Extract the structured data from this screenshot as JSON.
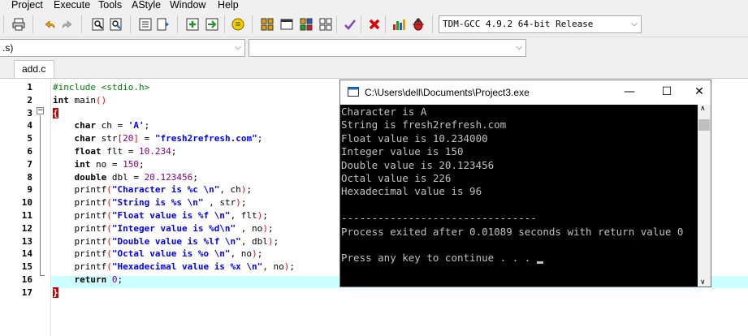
{
  "menu": [
    "Project",
    "Execute",
    "Tools",
    "AStyle",
    "Window",
    "Help"
  ],
  "compiler_select": "TDM-GCC 4.9.2 64-bit Release",
  "scope_select": ".s)",
  "tab_label": "add.c",
  "code_lines": [
    {
      "n": "1",
      "html": "<span class='pp'>#include &lt;stdio.h&gt;</span>"
    },
    {
      "n": "2",
      "html": "<span class='kw'>int</span> main<span class='pn'>()</span>"
    },
    {
      "n": "3",
      "html": "<span class='brace-red'>{</span>"
    },
    {
      "n": "4",
      "html": "    <span class='kw'>char</span> ch = <span class='str'>'A'</span>;"
    },
    {
      "n": "5",
      "html": "    <span class='kw'>char</span> str<span class='pn'>[</span><span class='num'>20</span><span class='pn'>]</span> = <span class='str'>\"fresh2refresh.com\"</span>;"
    },
    {
      "n": "6",
      "html": "    <span class='kw'>float</span> flt = <span class='num'>10.234</span>;"
    },
    {
      "n": "7",
      "html": "    <span class='kw'>int</span> no = <span class='num'>150</span>;"
    },
    {
      "n": "8",
      "html": "    <span class='kw'>double</span> dbl = <span class='num'>20.123456</span>;"
    },
    {
      "n": "9",
      "html": "    printf<span class='pn'>(</span><span class='str'>\"Character is %c \\n\"</span>, ch<span class='pn'>)</span>;"
    },
    {
      "n": "10",
      "html": "    printf<span class='pn'>(</span><span class='str'>\"String is %s \\n\"</span> , str<span class='pn'>)</span>;"
    },
    {
      "n": "11",
      "html": "    printf<span class='pn'>(</span><span class='str'>\"Float value is %f \\n\"</span>, flt<span class='pn'>)</span>;"
    },
    {
      "n": "12",
      "html": "    printf<span class='pn'>(</span><span class='str'>\"Integer value is %d\\n\"</span> , no<span class='pn'>)</span>;"
    },
    {
      "n": "13",
      "html": "    printf<span class='pn'>(</span><span class='str'>\"Double value is %lf \\n\"</span>, dbl<span class='pn'>)</span>;"
    },
    {
      "n": "14",
      "html": "    printf<span class='pn'>(</span><span class='str'>\"Octal value is %o \\n\"</span>, no<span class='pn'>)</span>;"
    },
    {
      "n": "15",
      "html": "    printf<span class='pn'>(</span><span class='str'>\"Hexadecimal value is %x \\n\"</span>, no<span class='pn'>)</span>;"
    },
    {
      "n": "16",
      "html": "    <span class='kw'>return</span> <span class='num'>0</span>;"
    },
    {
      "n": "17",
      "html": "<span class='brace-red'>}</span>"
    }
  ],
  "console": {
    "title": "C:\\Users\\dell\\Documents\\Project3.exe",
    "lines": [
      "Character is A",
      "String is fresh2refresh.com",
      "Float value is 10.234000",
      "Integer value is 150",
      "Double value is 20.123456",
      "Octal value is 226",
      "Hexadecimal value is 96",
      "",
      "--------------------------------",
      "Process exited after 0.01089 seconds with return value 0",
      "",
      "Press any key to continue . . . "
    ]
  },
  "colors": {
    "accent_line": "#ccffff",
    "keyword_string": "#0000ff",
    "preprocessor": "#008000",
    "number": "#800080"
  },
  "icons": [
    "print-icon",
    "undo-icon",
    "redo-icon",
    "find-icon",
    "replace-icon",
    "indent-icon",
    "unindent-icon",
    "add-bookmark-icon",
    "goto-bookmark-icon",
    "toggle-comment-icon",
    "compile-icon",
    "run-icon",
    "compile-run-icon",
    "rebuild-icon",
    "check-icon",
    "stop-icon",
    "chart-icon",
    "debug-icon"
  ]
}
